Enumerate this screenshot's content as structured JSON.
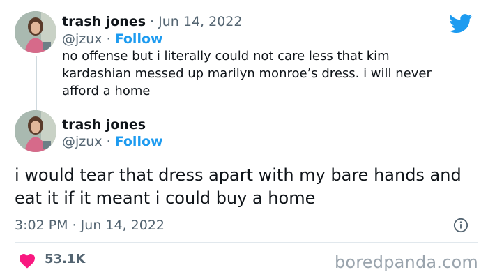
{
  "tweet1": {
    "display_name": "trash jones",
    "date": "Jun 14, 2022",
    "handle": "@jzux",
    "follow": "Follow",
    "text": "no offense but i literally could not care less that kim kardashian messed up marilyn monroe’s dress. i will never afford a home"
  },
  "tweet2": {
    "display_name": "trash jones",
    "handle": "@jzux",
    "follow": "Follow",
    "text": "i would tear that dress apart with my bare hands and eat it if it meant i could buy a home",
    "timestamp": "3:02 PM · Jun 14, 2022",
    "likes": "53.1K"
  },
  "watermark": "boredpanda.com",
  "colors": {
    "twitter_blue": "#1d9bf0",
    "heart_pink": "#f91880",
    "muted_text": "#536471",
    "thread_line": "#cfd9de"
  },
  "icons": [
    "twitter-bird-icon",
    "info-icon",
    "heart-icon"
  ]
}
